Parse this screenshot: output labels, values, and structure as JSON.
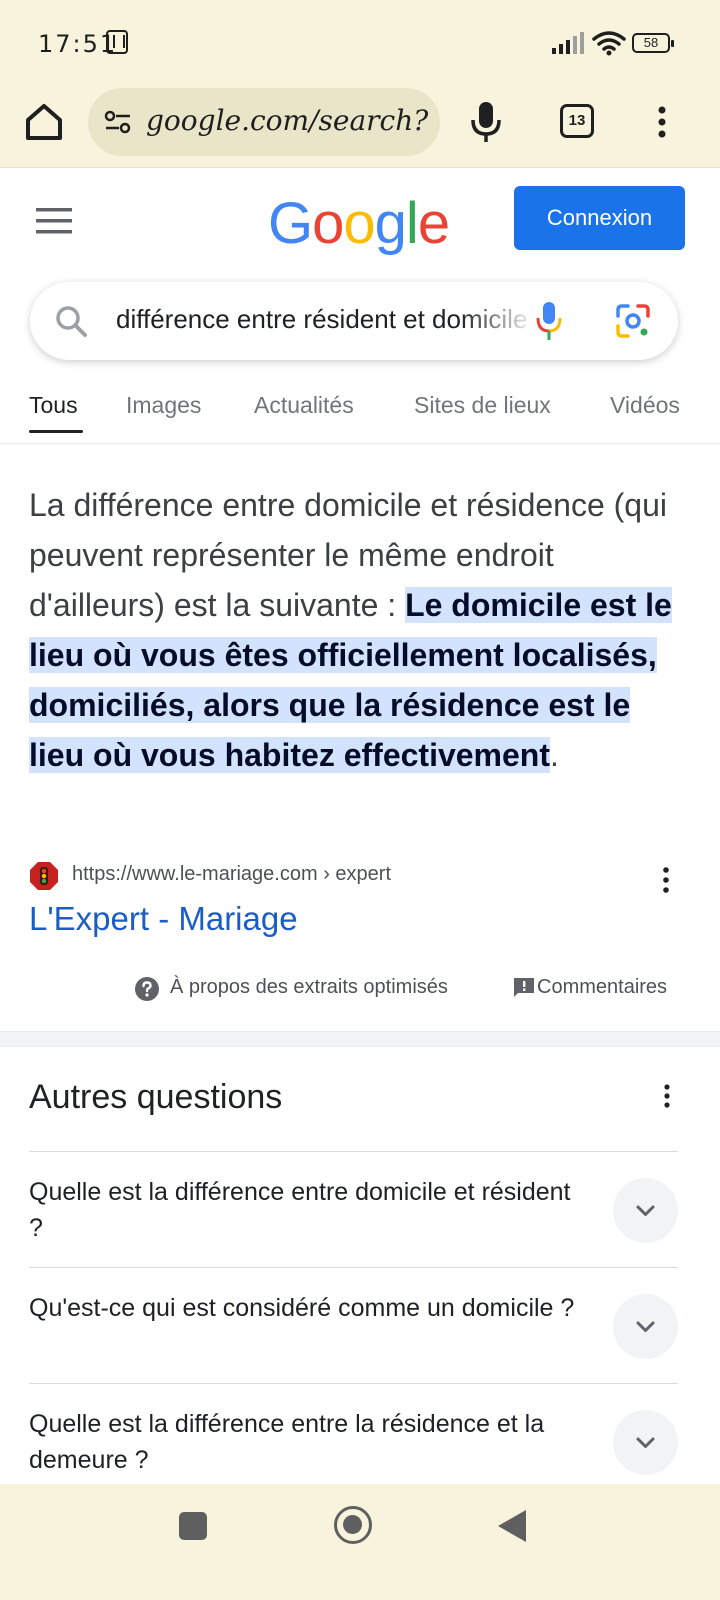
{
  "status_bar": {
    "time": "17:51",
    "battery": "58"
  },
  "browser": {
    "url": "google.com/search?q=",
    "tab_count": "13"
  },
  "header": {
    "logo_letters": [
      {
        "char": "G",
        "color": "#4285f4"
      },
      {
        "char": "o",
        "color": "#ea4335"
      },
      {
        "char": "o",
        "color": "#fbbc05"
      },
      {
        "char": "g",
        "color": "#4285f4"
      },
      {
        "char": "l",
        "color": "#34a853"
      },
      {
        "char": "e",
        "color": "#ea4335"
      }
    ],
    "signin_label": "Connexion"
  },
  "search": {
    "query": "différence entre résident et domicile"
  },
  "tabs": [
    {
      "label": "Tous",
      "active": true
    },
    {
      "label": "Images",
      "active": false
    },
    {
      "label": "Actualités",
      "active": false
    },
    {
      "label": "Sites de lieux",
      "active": false
    },
    {
      "label": "Vidéos",
      "active": false
    }
  ],
  "snippet": {
    "text_intro": "La différence entre domicile et résidence (qui peuvent représenter le même endroit d'ailleurs) est la suivante : ",
    "text_highlight": "Le domicile est le lieu où vous êtes officiellement localisés, domiciliés, alors que la résidence est le lieu où vous habitez effectivement",
    "text_end": ".",
    "source_url": "https://www.le-mariage.com › expert",
    "source_title": "L'Expert - Mariage",
    "about_label": "À propos des extraits optimisés",
    "feedback_label": "Commentaires"
  },
  "paa": {
    "title": "Autres questions",
    "questions": [
      "Quelle est la différence entre domicile et résident ?",
      "Qu'est-ce qui est considéré comme un domicile ?",
      "Quelle est la différence entre la résidence et la demeure ?"
    ]
  },
  "colors": {
    "accent": "#1a73e8",
    "highlight": "#d3e3fd",
    "chrome_bar": "#f8f3dc"
  }
}
